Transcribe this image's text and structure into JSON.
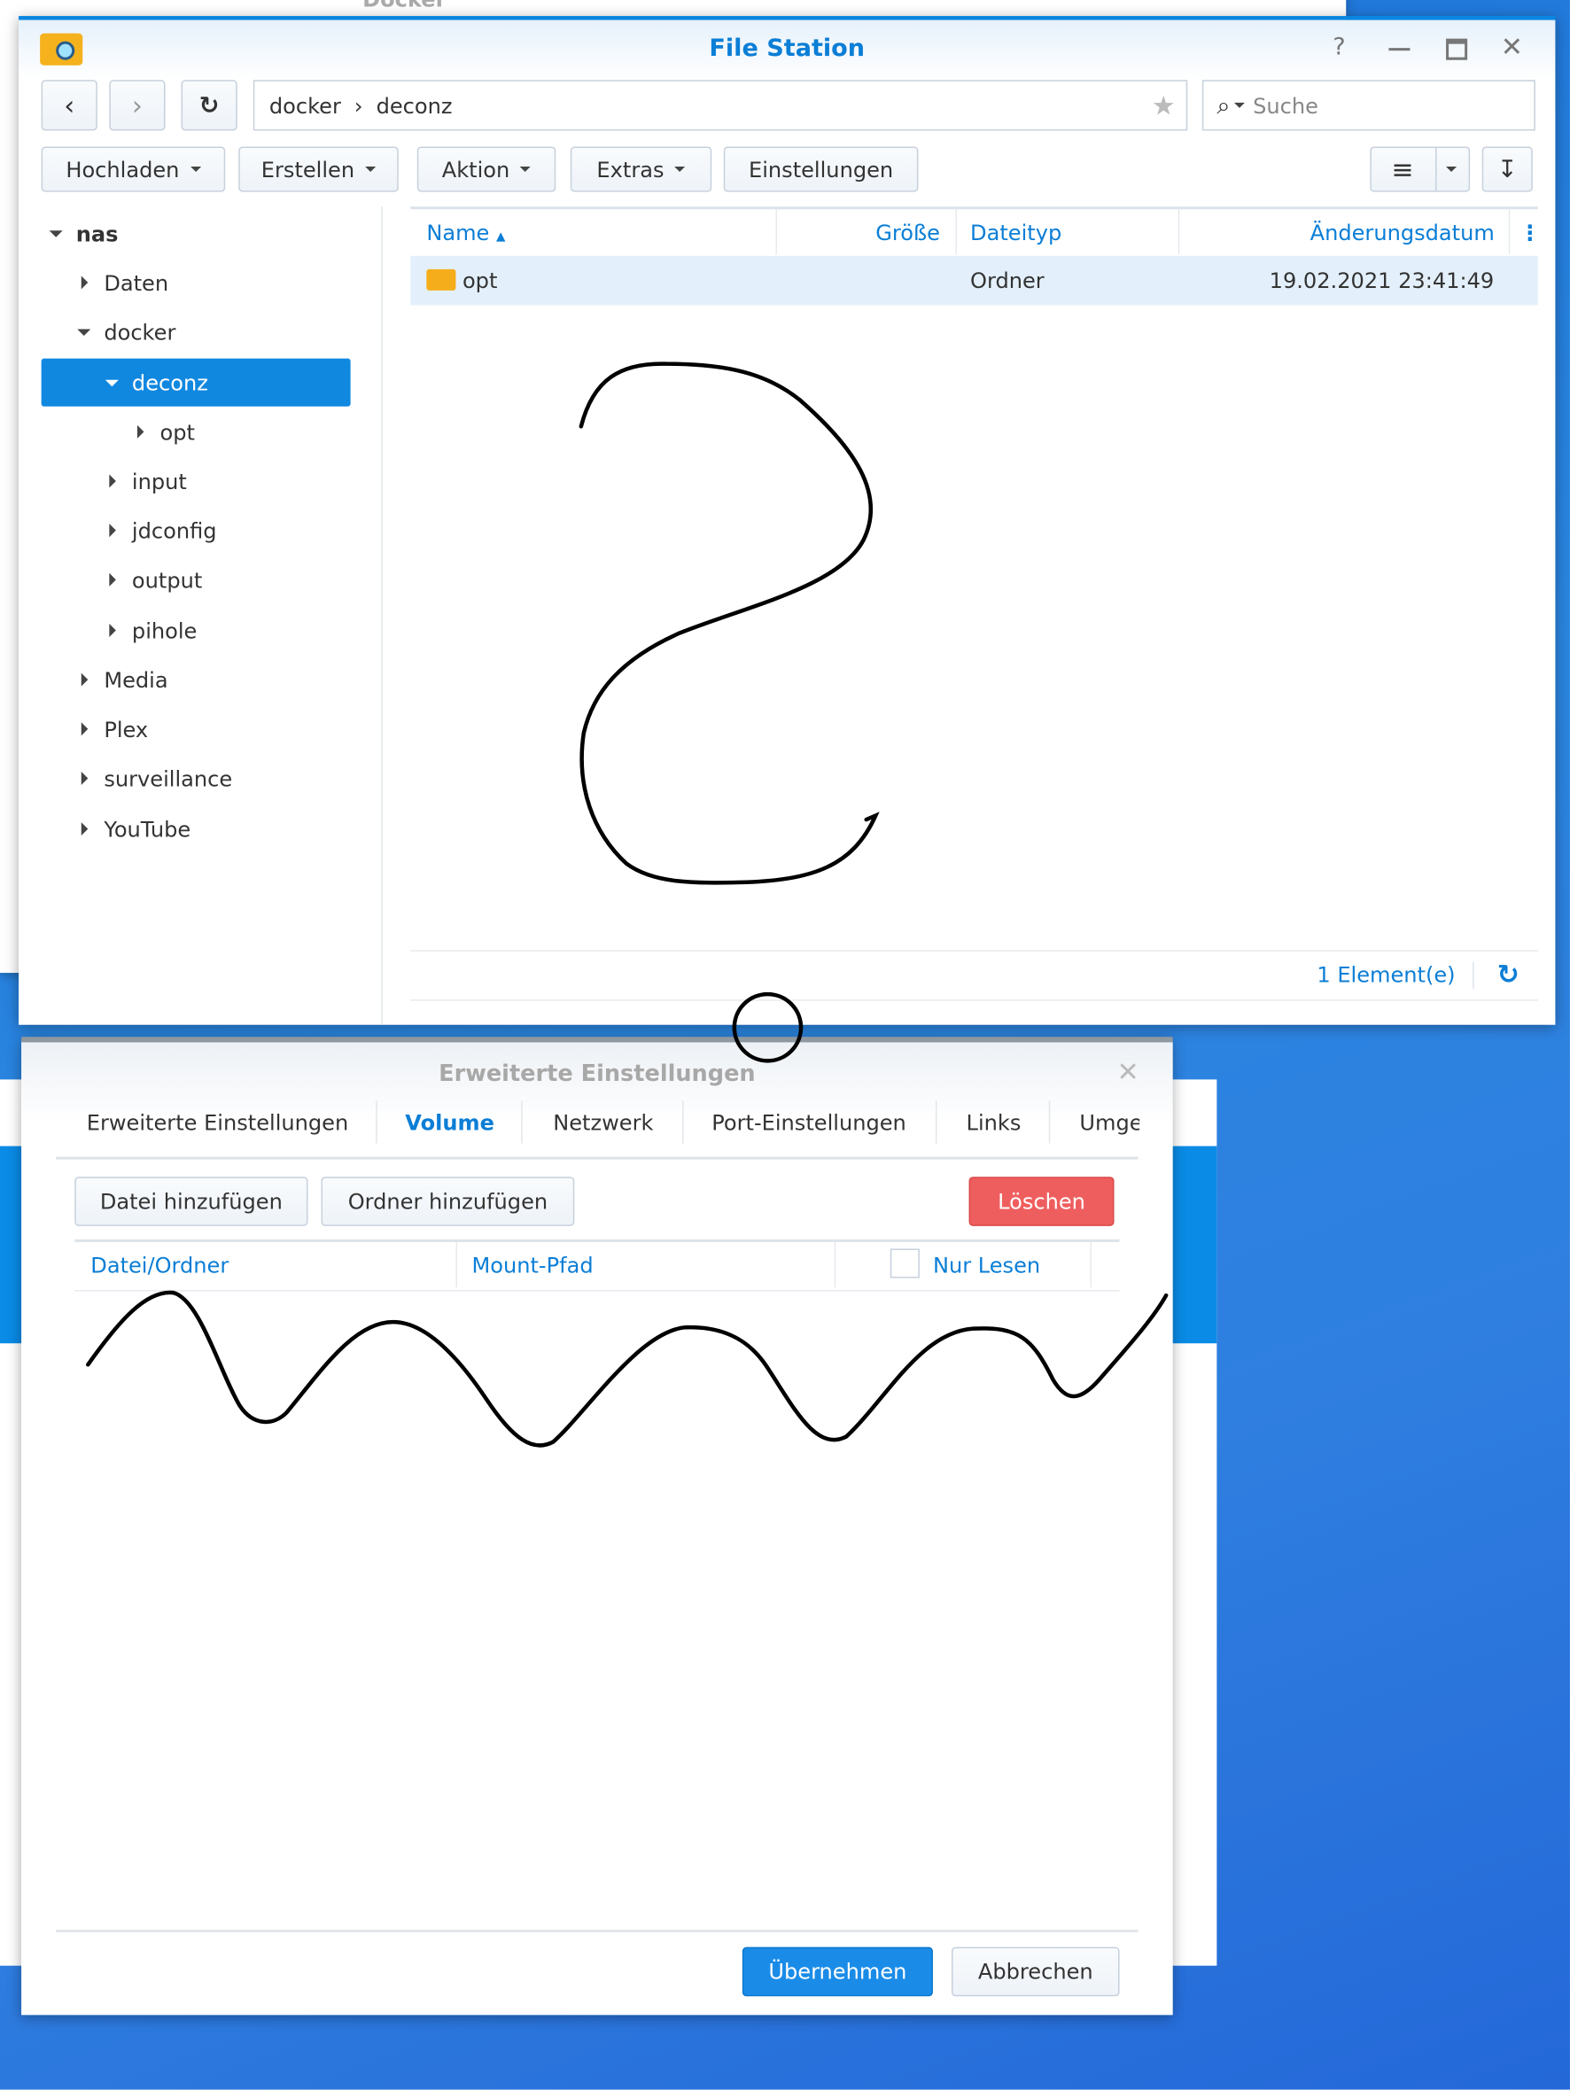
{
  "background_window": {
    "title": "Docker"
  },
  "file_station": {
    "title": "File Station",
    "window_controls": [
      "help-icon",
      "minimize-icon",
      "maximize-icon",
      "close-icon"
    ],
    "path": [
      "docker",
      "deconz"
    ],
    "search_placeholder": "Suche",
    "toolbar": {
      "upload": "Hochladen",
      "create": "Erstellen",
      "action": "Aktion",
      "extras": "Extras",
      "settings": "Einstellungen"
    },
    "tree": {
      "root": "nas",
      "items": [
        {
          "label": "Daten"
        },
        {
          "label": "docker"
        },
        {
          "label": "deconz"
        },
        {
          "label": "opt"
        },
        {
          "label": "input"
        },
        {
          "label": "jdconfig"
        },
        {
          "label": "output"
        },
        {
          "label": "pihole"
        },
        {
          "label": "Media"
        },
        {
          "label": "Plex"
        },
        {
          "label": "surveillance"
        },
        {
          "label": "YouTube"
        }
      ]
    },
    "columns": {
      "name": "Name",
      "size": "Größe",
      "type": "Dateityp",
      "modified": "Änderungsdatum"
    },
    "rows": [
      {
        "name": "opt",
        "size": "",
        "type": "Ordner",
        "modified": "19.02.2021 23:41:49"
      }
    ],
    "status": "1 Element(e)",
    "accent": "#0b7ed6",
    "selected_bg": "#1188e0"
  },
  "dialog": {
    "title": "Erweiterte Einstellungen",
    "tabs": [
      "Erweiterte Einstellungen",
      "Volume",
      "Netzwerk",
      "Port-Einstellungen",
      "Links",
      "Umge"
    ],
    "active_tab": "Volume",
    "add_file": "Datei hinzufügen",
    "add_folder": "Ordner hinzufügen",
    "delete": "Löschen",
    "columns": {
      "file": "Datei/Ordner",
      "mount": "Mount-Pfad",
      "readonly": "Nur Lesen"
    },
    "apply": "Übernehmen",
    "cancel": "Abbrechen",
    "delete_color": "#ef5e5e",
    "apply_color": "#1a8ce8"
  }
}
